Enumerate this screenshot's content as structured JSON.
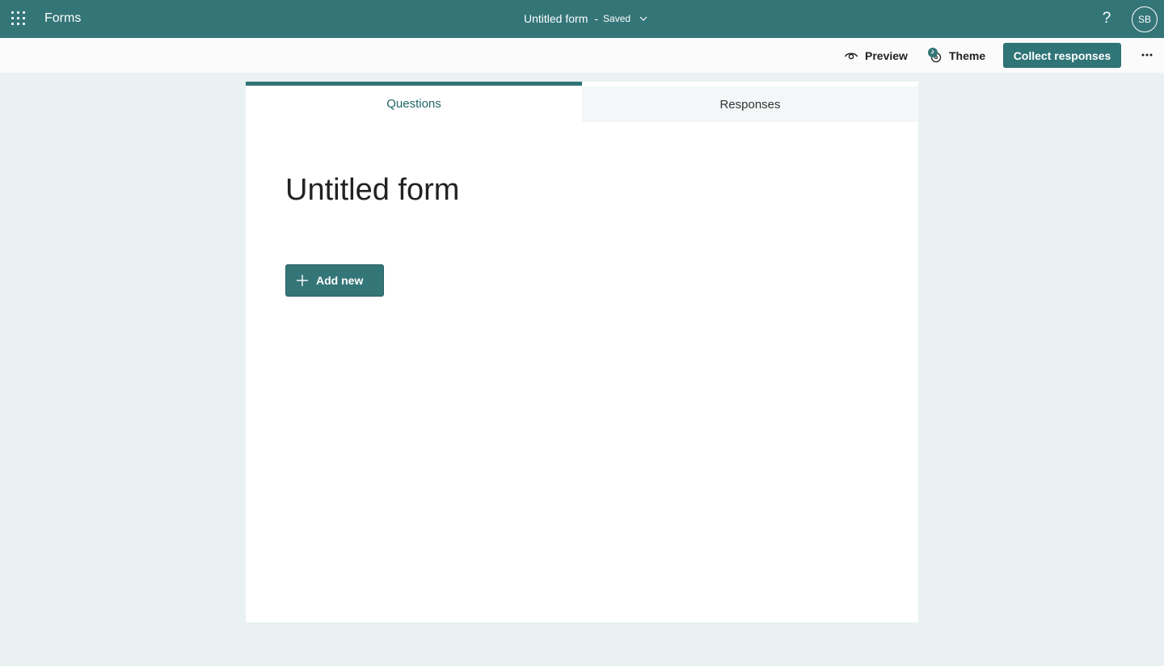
{
  "topbar": {
    "app_name": "Forms",
    "form_title": "Untitled form",
    "separator": "-",
    "save_status": "Saved",
    "help": "?",
    "avatar_initials": "SB"
  },
  "commands": {
    "preview_label": "Preview",
    "theme_label": "Theme",
    "collect_label": "Collect responses",
    "more": "···"
  },
  "tabs": [
    {
      "label": "Questions",
      "active": true
    },
    {
      "label": "Responses",
      "active": false
    }
  ],
  "form": {
    "title": "Untitled form",
    "add_new_label": "Add new"
  },
  "colors": {
    "brand": "#347578",
    "background": "#eaf1f2"
  }
}
